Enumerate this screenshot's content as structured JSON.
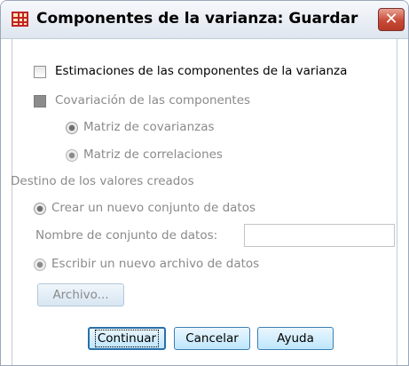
{
  "window": {
    "title": "Componentes de la varianza: Guardar",
    "close_label": "✕"
  },
  "options": {
    "estimaciones_label": "Estimaciones de las componentes de la varianza",
    "estimaciones_checked": false,
    "covariacion_label": "Covariación de las componentes",
    "covariacion_checked": false,
    "matriz_covarianzas_label": "Matriz de covarianzas",
    "matriz_correlaciones_label": "Matriz de correlaciones"
  },
  "destination": {
    "group_label": "Destino de los valores creados",
    "new_dataset_label": "Crear un nuevo conjunto de datos",
    "dataset_name_label": "Nombre de conjunto de datos:",
    "dataset_name_value": "",
    "new_file_label": "Escribir un nuevo archivo de datos",
    "file_button_label": "Archivo..."
  },
  "buttons": {
    "continue_label": "Continuar",
    "cancel_label": "Cancelar",
    "help_label": "Ayuda"
  }
}
